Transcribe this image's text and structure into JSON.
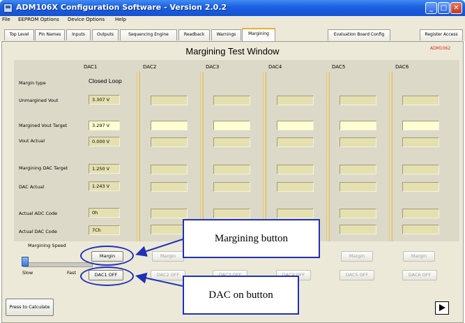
{
  "window": {
    "title": "ADM106X Configuration Software -  Version 2.0.2",
    "minimize": "_",
    "maximize": "□",
    "close": "✕"
  },
  "menu": [
    "File",
    "EEPROM Options",
    "Device Options",
    "Help"
  ],
  "tabs": [
    {
      "label": "Top Level"
    },
    {
      "label": "Pin Names"
    },
    {
      "label": "Inputs"
    },
    {
      "label": "Outputs"
    },
    {
      "label": "Sequencing Engine"
    },
    {
      "label": "Readback"
    },
    {
      "label": "Warnings"
    },
    {
      "label": "Margining",
      "active": true
    },
    {
      "label": "Evaluation Board Config"
    },
    {
      "label": "Register Access"
    }
  ],
  "panel": {
    "title": "Margining Test Window",
    "device": "ADM1062",
    "columns": [
      "DAC1",
      "DAC2",
      "DAC3",
      "DAC4",
      "DAC5",
      "DAC6"
    ],
    "rows": {
      "margin_type": "Margin type",
      "unmargined_vout": "Unmargined Vout",
      "margined_vout_target": "Margined Vout Target",
      "vout_actual": "Vout Actual",
      "margining_dac_target": "Margining DAC Target",
      "dac_actual": "DAC Actual",
      "actual_adc_code": "Actual ADC Code",
      "actual_dac_code": "Actual DAC Code"
    },
    "dac1": {
      "margin_type": "Closed Loop",
      "unmargined_vout": "3.307 V",
      "margined_vout_target": "3.297 V",
      "vout_actual": "0.000 V",
      "margining_dac_target": "1.250 V",
      "dac_actual": "1.243 V",
      "actual_adc_code": "0h",
      "actual_dac_code": "7Ch"
    },
    "margining_speed": "Margining Speed",
    "slow": "Slow",
    "fast": "Fast",
    "speed_level": 0,
    "margin_buttons": [
      "Margin",
      "Margin",
      "Margin",
      "Margin",
      "Margin",
      "Margin"
    ],
    "dac_off_buttons": [
      "DAC1 OFF",
      "DAC2 OFF",
      "DAC3 OFF",
      "DAC4 OFF",
      "DAC5 OFF",
      "DAC6 OFF"
    ],
    "calculate_button": "Press to Calculate"
  },
  "callouts": {
    "margining_button": "Margining button",
    "dac_on_button": "DAC on button"
  },
  "colors": {
    "annotation": "#2030b8",
    "device_code": "#e02020",
    "field": "#e4e0b0",
    "target_field": "#fffed0"
  },
  "icons": {
    "play": "play-icon",
    "app": "app-icon"
  }
}
